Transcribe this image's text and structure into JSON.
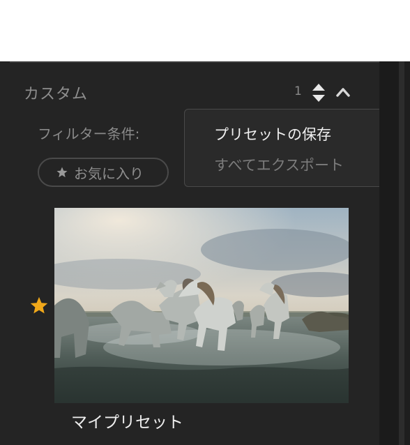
{
  "section": {
    "title": "カスタム",
    "count": "1"
  },
  "icons": {
    "stepper": "sort-stepper-icon",
    "collapse": "chevron-up-icon",
    "favorite": "star-icon"
  },
  "filter": {
    "label": "フィルター条件:",
    "favorite_chip": "お気に入り"
  },
  "menu": {
    "items": [
      {
        "label": "プリセットの保存",
        "enabled": true
      },
      {
        "label": "すべてエクスポート",
        "enabled": false
      }
    ]
  },
  "preset": {
    "name": "マイプリセット",
    "favorited": true,
    "thumbnail": "white horses running through water"
  },
  "colors": {
    "panel": "#242424",
    "star": "#f0a81a",
    "text_active": "#f0f0f0",
    "text_muted": "#8a8a8a"
  }
}
